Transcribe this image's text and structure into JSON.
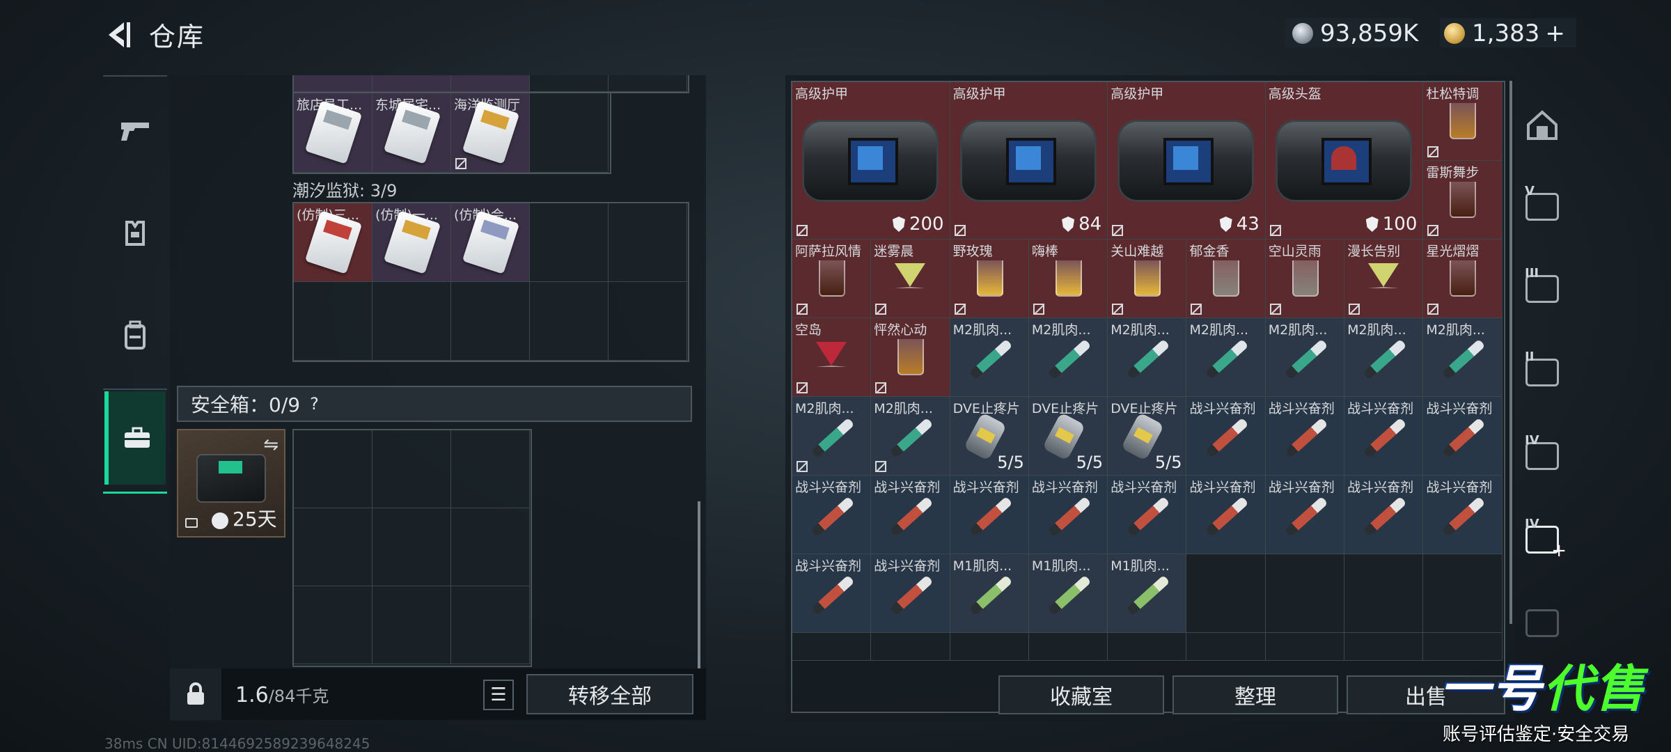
{
  "header": {
    "title": "仓库",
    "currency_silver": "93,859K",
    "currency_gold": "1,383",
    "add_label": "+"
  },
  "left": {
    "top_labels": [
      "旅店员工...",
      "东城居宅...",
      "海洋监测厅"
    ],
    "section_label": "潮汐监狱: 3/9",
    "forged_labels": [
      "(仿制)三...",
      "(仿制)一...",
      "(仿制)会..."
    ],
    "safebox_label": "安全箱：0/9",
    "safebox_days": "25天",
    "weight_value": "1.6",
    "weight_max": "/84千克",
    "transfer_all": "转移全部"
  },
  "right": {
    "big_items": [
      {
        "label": "高级护甲",
        "durability": "200",
        "logo": "blue"
      },
      {
        "label": "高级护甲",
        "durability": "84",
        "logo": "blue"
      },
      {
        "label": "高级护甲",
        "durability": "43",
        "logo": "blue"
      },
      {
        "label": "高级头盔",
        "durability": "100",
        "logo": "red"
      }
    ],
    "side_drinks": [
      "杜松特调",
      "雷斯舞步"
    ],
    "row3": [
      "阿萨拉风情",
      "迷雾晨",
      "野玫瑰",
      "嗨棒",
      "关山难越",
      "郁金香",
      "空山灵雨",
      "漫长告别",
      "星光熠熠"
    ],
    "row4": [
      {
        "label": "空岛",
        "kind": "drink"
      },
      {
        "label": "怦然心动",
        "kind": "drink"
      },
      {
        "label": "M2肌肉...",
        "kind": "m2"
      },
      {
        "label": "M2肌肉...",
        "kind": "m2"
      },
      {
        "label": "M2肌肉...",
        "kind": "m2"
      },
      {
        "label": "M2肌肉...",
        "kind": "m2"
      },
      {
        "label": "M2肌肉...",
        "kind": "m2"
      },
      {
        "label": "M2肌肉...",
        "kind": "m2"
      },
      {
        "label": "M2肌肉...",
        "kind": "m2"
      }
    ],
    "row5": [
      {
        "label": "M2肌肉...",
        "kind": "m2"
      },
      {
        "label": "M2肌肉...",
        "kind": "m2"
      },
      {
        "label": "DVE止疼片",
        "kind": "pill",
        "count": "5/5"
      },
      {
        "label": "DVE止疼片",
        "kind": "pill",
        "count": "5/5"
      },
      {
        "label": "DVE止疼片",
        "kind": "pill",
        "count": "5/5"
      },
      {
        "label": "战斗兴奋剂",
        "kind": "stim"
      },
      {
        "label": "战斗兴奋剂",
        "kind": "stim"
      },
      {
        "label": "战斗兴奋剂",
        "kind": "stim"
      },
      {
        "label": "战斗兴奋剂",
        "kind": "stim"
      }
    ],
    "row6": [
      "战斗兴奋剂",
      "战斗兴奋剂",
      "战斗兴奋剂",
      "战斗兴奋剂",
      "战斗兴奋剂",
      "战斗兴奋剂",
      "战斗兴奋剂",
      "战斗兴奋剂",
      "战斗兴奋剂"
    ],
    "row7": [
      {
        "label": "战斗兴奋剂",
        "kind": "stim"
      },
      {
        "label": "战斗兴奋剂",
        "kind": "stim"
      },
      {
        "label": "M1肌肉...",
        "kind": "m1"
      },
      {
        "label": "M1肌肉...",
        "kind": "m1"
      },
      {
        "label": "M1肌肉...",
        "kind": "m1"
      }
    ],
    "buttons": [
      "收藏室",
      "整理",
      "出售"
    ]
  },
  "right_rail_labels": [
    "V",
    "III",
    "II",
    "IV",
    "IV"
  ],
  "watermark": {
    "main_a": "一号",
    "main_b": "代售",
    "sub": "账号评估鉴定·安全交易"
  },
  "status_bar": "38ms   CN UID:8144692589239648245",
  "colors": {
    "accent": "#1bd99a",
    "item_red": "#5b2a2e",
    "item_blue": "#2c3848"
  }
}
